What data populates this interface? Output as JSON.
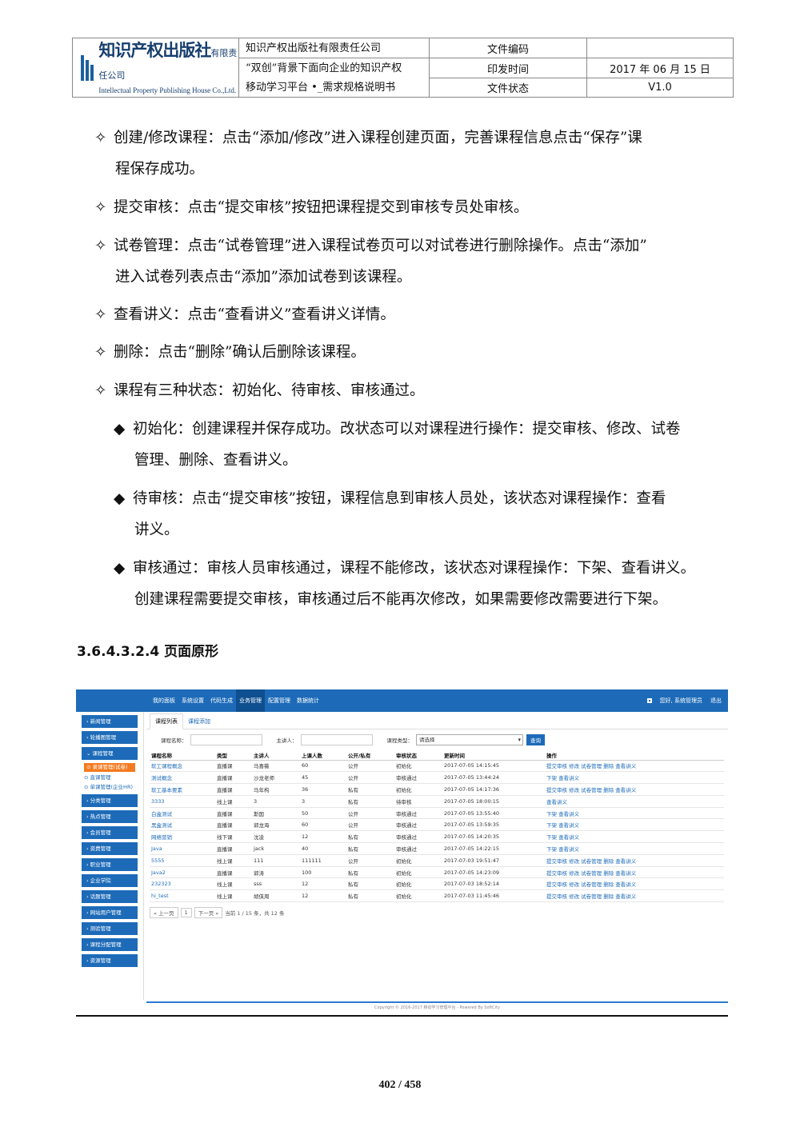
{
  "header": {
    "logo_cn": "知识产权出版社",
    "logo_cn_suffix": "有限责任公司",
    "logo_en": "Intellectual Property Publishing House Co.,Ltd.",
    "company": "知识产权出版社有限责任公司",
    "project_line1": "“双创”背景下面向企业的知识产权",
    "project_line2": "移动学习平台 •_需求规格说明书",
    "label_code": "文件编码",
    "value_code": "",
    "label_date": "印发时间",
    "value_date": "2017 年 06 月 15 日",
    "label_status": "文件状态",
    "value_status": "V1.0"
  },
  "body": {
    "p1_l1": "创建/修改课程：点击“添加/修改”进入课程创建页面，完善课程信息点击“保存”课",
    "p1_l2": "程保存成功。",
    "p2": "提交审核：点击“提交审核”按钮把课程提交到审核专员处审核。",
    "p3_l1": "试卷管理：点击“试卷管理”进入课程试卷页可以对试卷进行删除操作。点击“添加”",
    "p3_l2": "进入试卷列表点击“添加”添加试卷到该课程。",
    "p4": "查看讲义：点击“查看讲义”查看讲义详情。",
    "p5": "删除：点击“删除”确认后删除该课程。",
    "p6": "课程有三种状态：初始化、待审核、审核通过。",
    "s1_l1": "初始化：创建课程并保存成功。改状态可以对课程进行操作：提交审核、修改、试卷",
    "s1_l2": "管理、删除、查看讲义。",
    "s2_l1": "待审核：点击“提交审核”按钮，课程信息到审核人员处，该状态对课程操作：查看",
    "s2_l2": "讲义。",
    "s3_l1": "审核通过：审核人员审核通过，课程不能修改，该状态对课程操作：下架、查看讲义。",
    "s3_l2": "创建课程需要提交审核，审核通过后不能再次修改，如果需要修改需要进行下架。",
    "bullet_hollow": "✧",
    "bullet_solid": "◆",
    "heading": "3.6.4.3.2.4 页面原形"
  },
  "screenshot": {
    "nav": [
      "我的面板",
      "系统设置",
      "代码生成",
      "业务管理",
      "配置管理",
      "数据统计"
    ],
    "nav_active": "业务管理",
    "user_greeting": "您好, 系统管理员",
    "logout": "退出",
    "sidebar_before": [
      "新闻管理",
      "轮播图管理"
    ],
    "sidebar_open": "课程管理",
    "sidebar_subs": [
      "录课管理(试卷)",
      "直课管理",
      "单课管理(企业HR)"
    ],
    "sidebar_after": [
      "分类管理",
      "热点管理",
      "会员管理",
      "资费管理",
      "职业管理",
      "企业学院",
      "话题管理",
      "网站用户管理",
      "测验管理",
      "课程分配管理",
      "资源管理"
    ],
    "tab_list": "课程列表",
    "tab_add": "课程添加",
    "filter_name": "课程名称：",
    "filter_lecturer": "主讲人：",
    "filter_type": "课程类型：",
    "filter_select": "请选择",
    "filter_btn": "查询",
    "columns": [
      "课程名称",
      "类型",
      "主讲人",
      "上课人数",
      "公开/私有",
      "审核状态",
      "更新时间",
      "操作"
    ],
    "rows": [
      [
        "软工课程概念",
        "直播课",
        "马喜薇",
        "60",
        "公开",
        "初始化",
        "2017-07-05 14:15:45",
        "提交审核 修改 试卷管理 删除 查看讲义"
      ],
      [
        "测试概念",
        "直播课",
        "沙龙老师",
        "45",
        "公开",
        "审核通过",
        "2017-07-05 13:44:24",
        "下架 查看讲义"
      ],
      [
        "软工基本要素",
        "直播课",
        "马年构",
        "36",
        "私有",
        "初始化",
        "2017-07-05 14:17:36",
        "提交审核 修改 试卷管理 删除 查看讲义"
      ],
      [
        "3333",
        "线上课",
        "3",
        "3",
        "私有",
        "待审核",
        "2017-07-05 18:00:15",
        "查看讲义"
      ],
      [
        "白盒测试",
        "直播课",
        "斯国",
        "50",
        "公开",
        "审核通过",
        "2017-07-05 13:55:40",
        "下架 查看讲义"
      ],
      [
        "黑盒测试",
        "直播课",
        "郭龙海",
        "60",
        "公开",
        "审核通过",
        "2017-07-05 13:59:35",
        "下架 查看讲义"
      ],
      [
        "网络营销",
        "线下课",
        "沈凌",
        "12",
        "私有",
        "审核通过",
        "2017-07-05 14:20:35",
        "下架 查看讲义"
      ],
      [
        "Java",
        "直播课",
        "jack",
        "40",
        "私有",
        "审核通过",
        "2017-07-05 14:22:15",
        "下架 查看讲义"
      ],
      [
        "5555",
        "线上课",
        "111",
        "111111",
        "公开",
        "初始化",
        "2017-07-03 19:51:47",
        "提交审核 修改 试卷管理 删除 查看讲义"
      ],
      [
        "Java2",
        "直播课",
        "郭涛",
        "100",
        "私有",
        "初始化",
        "2017-07-05 14:23:09",
        "提交审核 修改 试卷管理 删除 查看讲义"
      ],
      [
        "232323",
        "线上课",
        "sss",
        "12",
        "私有",
        "初始化",
        "2017-07-03 18:52:14",
        "提交审核 修改 试卷管理 删除 查看讲义"
      ],
      [
        "hi_test",
        "线上课",
        "胡侠周",
        "12",
        "私有",
        "初始化",
        "2017-07-03 11:45:46",
        "提交审核 修改 试卷管理 删除 查看讲义"
      ]
    ],
    "pager_prev": "« 上一页",
    "pager_page": "1",
    "pager_next": "下一页 »",
    "pager_info": "当前 1 / 15 条，共 12 条",
    "copyright": "Copyright © 2016-2017 移动学习管理平台 - Powered By SoftCity"
  },
  "page_number": "402 / 458"
}
